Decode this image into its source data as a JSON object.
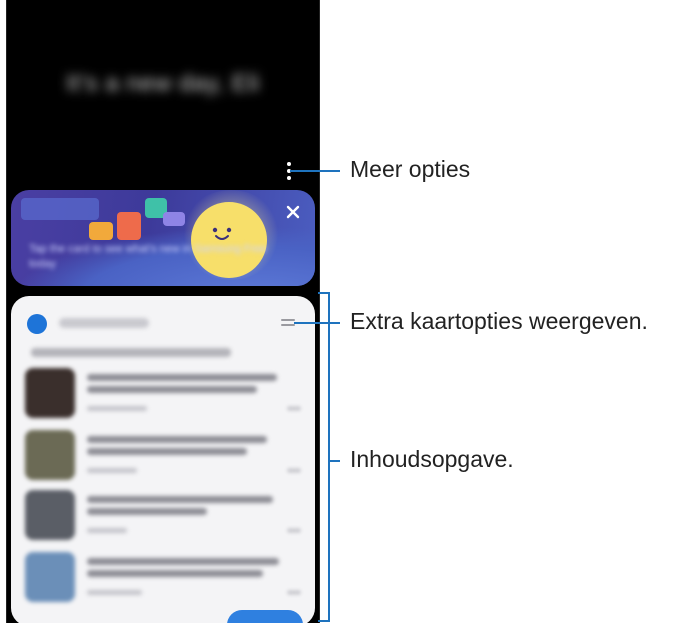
{
  "screen": {
    "greeting": "It's a new day, Eli",
    "banner_text": "Tap the card to see what's new in Samsung Free today",
    "card_title": "Samsung Daily",
    "card_subtitle": "Trending in Sports Entertainment News"
  },
  "callouts": {
    "more_options": "Meer opties",
    "extra_card_options": "Extra kaartopties weergeven.",
    "content": "Inhoudsopgave."
  },
  "colors": {
    "accent": "#1e73be",
    "banner": "#3d3a9a",
    "sun": "#f7df6a"
  }
}
